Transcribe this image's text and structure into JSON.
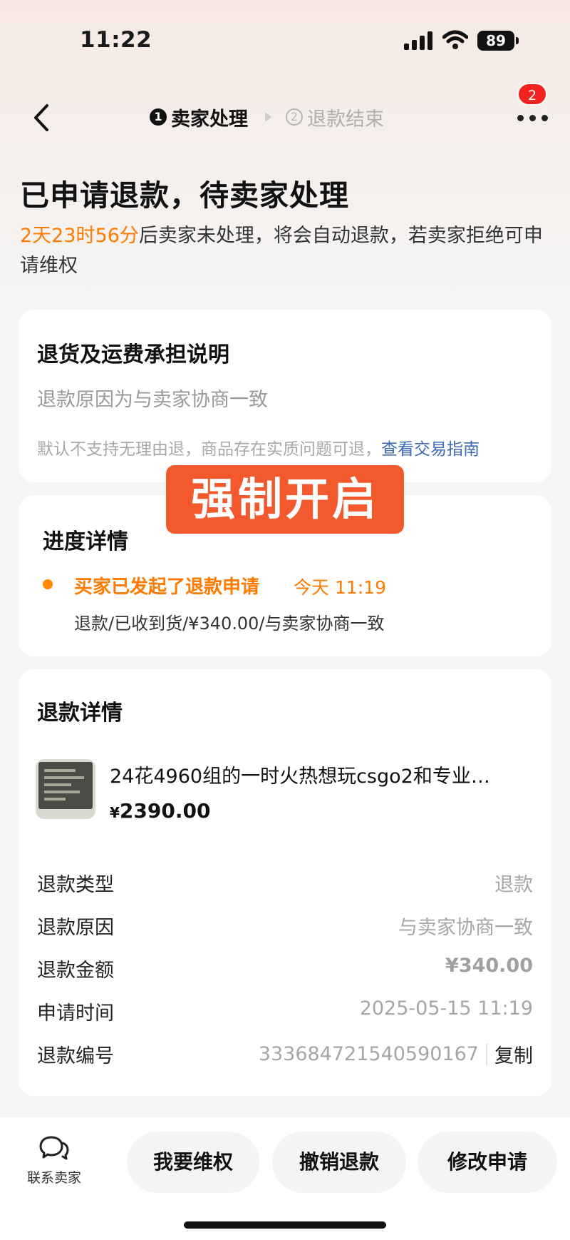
{
  "status_bar": {
    "time": "11:22",
    "battery": "89"
  },
  "nav": {
    "step1_num": "1",
    "step1_label": "卖家处理",
    "step2_num": "2",
    "step2_label": "退款结束",
    "badge_count": "2"
  },
  "header": {
    "title": "已申请退款，待卖家处理",
    "countdown": "2天23时56分",
    "description": "后卖家未处理，将会自动退款，若卖家拒绝可申请维权"
  },
  "return_info": {
    "title": "退货及运费承担说明",
    "reason": "退款原因为与卖家协商一致",
    "note": "默认不支持无理由退，商品存在实质问题可退，",
    "link": "查看交易指南"
  },
  "overlay_stamp": "强制开启",
  "progress": {
    "title": "进度详情",
    "event": "买家已发起了退款申请",
    "time": "今天 11:19",
    "detail": "退款/已收到货/¥340.00/与卖家协商一致"
  },
  "refund": {
    "title": "退款详情",
    "product_name": "24花4960组的一时火热想玩csgo2和专业…",
    "currency": "¥",
    "product_price": "2390.00",
    "rows": [
      {
        "label": "退款类型",
        "value": "退款"
      },
      {
        "label": "退款原因",
        "value": "与卖家协商一致"
      },
      {
        "label": "退款金额",
        "value": "¥340.00"
      },
      {
        "label": "申请时间",
        "value": "2025-05-15 11:19"
      },
      {
        "label": "退款编号",
        "value": "333684721540590167"
      }
    ],
    "copy_label": "复制"
  },
  "bottom": {
    "contact_label": "联系卖家",
    "btn_defend": "我要维权",
    "btn_cancel": "撤销退款",
    "btn_modify": "修改申请"
  },
  "colors": {
    "accent": "#ff7a00",
    "stamp": "#f25a2e",
    "link": "#3d6bb5",
    "badge": "#f0231f"
  }
}
